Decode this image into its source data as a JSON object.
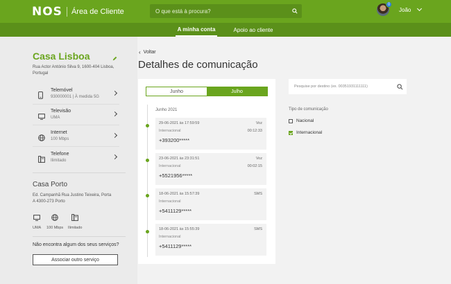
{
  "header": {
    "brand": "NOS",
    "area": "Área de Cliente",
    "search_placeholder": "O que está à procura?",
    "user_name": "João",
    "notification_count": "0",
    "bg_color": "#6aa51e"
  },
  "nav": {
    "tabs": [
      {
        "label": "A minha conta",
        "active": true
      },
      {
        "label": "Apoio ao cliente",
        "active": false
      }
    ]
  },
  "sidebar": {
    "house1": {
      "title": "Casa Lisboa",
      "address": "Rua Actor António Silva 9, 1600-404 Lisboa, Portugal",
      "services": [
        {
          "icon": "mobile-icon",
          "name": "Telemóvel",
          "detail": "930000001 | À medida 5G"
        },
        {
          "icon": "tv-icon",
          "name": "Televisão",
          "detail": "UMA"
        },
        {
          "icon": "globe-icon",
          "name": "Internet",
          "detail": "100 Mbps"
        },
        {
          "icon": "phone-icon",
          "name": "Telefone",
          "detail": "Ilimitado"
        }
      ]
    },
    "house2": {
      "title": "Casa Porto",
      "address": "Ed. Campanhã Rua Justino Teixeira, Porta A 4300-273 Porto",
      "services": [
        {
          "icon": "tv-icon",
          "label": "UMA"
        },
        {
          "icon": "globe-icon",
          "label": "100 Mbps"
        },
        {
          "icon": "phone-icon",
          "label": "Ilimitado"
        }
      ]
    },
    "question": "Não encontra algum dos seus serviços?",
    "associate_button": "Associar outro serviço"
  },
  "main": {
    "back": "Voltar",
    "title": "Detalhes de comunicação",
    "months": [
      {
        "label": "Junho",
        "active": false
      },
      {
        "label": "Julho",
        "active": true
      }
    ],
    "group_label": "Junho 2021",
    "calls": [
      {
        "datetime": "29-06-2021 às 17:59:59",
        "type": "Voz",
        "category": "Internacional",
        "duration": "00:12:33",
        "number": "+393200*****"
      },
      {
        "datetime": "23-06-2021 às 23:31:51",
        "type": "Voz",
        "category": "Internacional",
        "duration": "00:02:15",
        "number": "+5521956*****"
      },
      {
        "datetime": "18-06-2021 às 15:57:39",
        "type": "SMS",
        "category": "Internacional",
        "duration": "",
        "number": "+5411129*****"
      },
      {
        "datetime": "18-06-2021 às 15:55:39",
        "type": "SMS",
        "category": "Internacional",
        "duration": "",
        "number": "+5411129*****"
      }
    ]
  },
  "filters": {
    "search_placeholder": "Pesquise por destino (ex. 00351931111111)",
    "title": "Tipo de comunicação",
    "options": [
      {
        "label": "Nacional",
        "checked": false
      },
      {
        "label": "Internacional",
        "checked": true
      }
    ]
  }
}
